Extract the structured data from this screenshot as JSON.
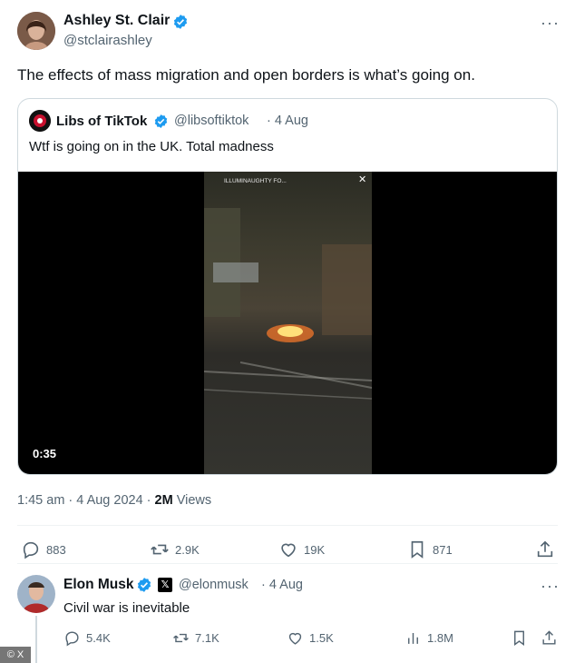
{
  "main_tweet": {
    "author_name": "Ashley St. Clair",
    "author_handle": "@stclairashley",
    "text": "The effects of mass migration and open borders is what’s going on.",
    "timestamp": "1:45 am · 4 Aug 2024 ·",
    "views_count": "2M",
    "views_label": "Views",
    "actions": {
      "replies": "883",
      "reposts": "2.9K",
      "likes": "19K",
      "bookmarks": "871"
    }
  },
  "quoted_tweet": {
    "author_name": "Libs of TikTok",
    "author_handle": "@libsoftiktok",
    "date": "· 4 Aug",
    "text": "Wtf is going on in the UK. Total madness",
    "video": {
      "duration": "0:35",
      "overlay_label": "ILLUMINAUGHTY FO..."
    }
  },
  "reply_tweet": {
    "author_name": "Elon Musk",
    "author_handle": "@elonmusk",
    "date": "· 4 Aug",
    "text": "Civil war is inevitable",
    "actions": {
      "replies": "5.4K",
      "reposts": "7.1K",
      "likes": "1.5K",
      "views": "1.8M"
    }
  },
  "watermark": "© X",
  "colors": {
    "verified_blue": "#1d9bf0",
    "muted_text": "#536471",
    "border": "#cfd9de"
  }
}
